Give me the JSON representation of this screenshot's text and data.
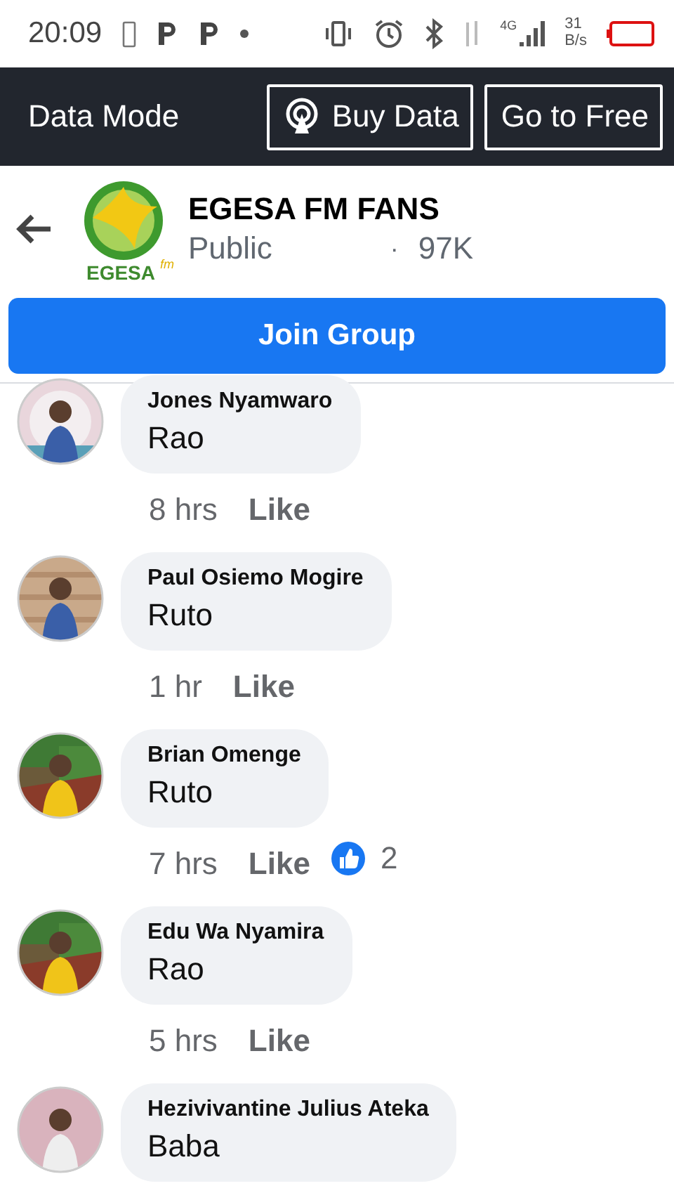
{
  "status_bar": {
    "time": "20:09",
    "network": "4G",
    "speed_value": "31",
    "speed_unit": "B/s"
  },
  "data_bar": {
    "label": "Data Mode",
    "buttons": [
      {
        "label": "Buy Data",
        "kind": "broadcast"
      },
      {
        "label": "Go to Free",
        "kind": "plain"
      }
    ]
  },
  "group": {
    "logo_text": "EGESA",
    "logo_suffix": "fm",
    "name": "EGESA FM FANS",
    "privacy": "Public",
    "separator": "·",
    "members": "97K"
  },
  "join_button": "Join Group",
  "comments": [
    {
      "author": "Jones Nyamwaro",
      "text": "Rao",
      "time": "8 hrs",
      "like": "Like"
    },
    {
      "author": "Paul Osiemo Mogire",
      "text": "Ruto",
      "time": "1 hr",
      "like": "Like"
    },
    {
      "author": "Brian Omenge",
      "text": "Ruto",
      "time": "7 hrs",
      "like": "Like",
      "reactions": "2"
    },
    {
      "author": "Edu Wa Nyamira",
      "text": "Rao",
      "time": "5 hrs",
      "like": "Like"
    },
    {
      "author": "Hezivivantine Julius Ateka",
      "text": "Baba"
    }
  ]
}
